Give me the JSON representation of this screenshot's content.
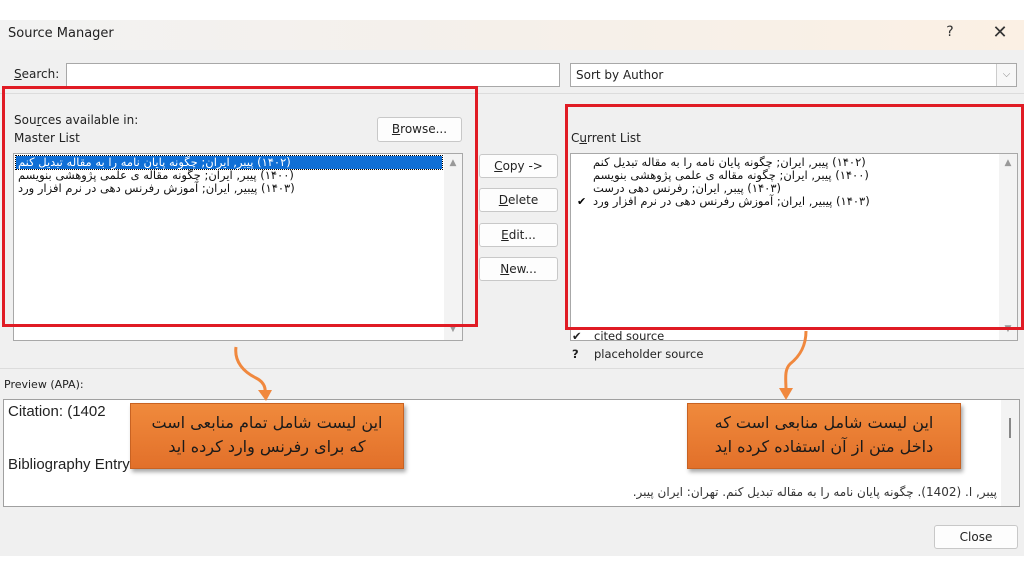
{
  "window": {
    "title": "Source Manager",
    "help_label": "?",
    "close_label": "✕"
  },
  "search": {
    "label_prefix": "",
    "label_underlined": "S",
    "label_rest": "earch:",
    "value": "",
    "placeholder": ""
  },
  "sort": {
    "selected": "Sort by Author",
    "arrow": "⌵"
  },
  "master": {
    "label_line1_a": "Sou",
    "label_line1_u": "r",
    "label_line1_b": "ces available in:",
    "label_line2": "Master List",
    "browse_u": "B",
    "browse_rest": "rowse...",
    "items": [
      {
        "text": "(۱۴۰۲) پیبر, ایران; چگونه پایان نامه را به مقاله تبدیل کنم",
        "selected": true
      },
      {
        "text": "(۱۴۰۰) پیبر, ایران; چگونه مقاله ی علمی پژوهشی بنویسم",
        "selected": false
      },
      {
        "text": "(۱۴۰۳) پیبیر, ایران; آموزش رفرنس دهی در نرم افزار ورد",
        "selected": false
      }
    ]
  },
  "actions": {
    "copy_u": "C",
    "copy_rest": "opy ->",
    "delete_u": "D",
    "delete_rest": "elete",
    "edit_u": "E",
    "edit_rest": "dit...",
    "new_u": "N",
    "new_rest": "ew..."
  },
  "current": {
    "label_a": "C",
    "label_u": "u",
    "label_b": "rrent List",
    "items": [
      {
        "text": "(۱۴۰۲) پیبر, ایران; چگونه پایان نامه را به مقاله تبدیل کنم",
        "cited": false
      },
      {
        "text": "(۱۴۰۰) پیبر, ایران; چگونه مقاله ی علمی پژوهشی بنویسم",
        "cited": false
      },
      {
        "text": "(۱۴۰۳) پیبر, ایران; رفرنس دهی درست",
        "cited": false
      },
      {
        "text": "(۱۴۰۳) پیبیر, ایران; آموزش رفرنس دهی در نرم افزار ورد",
        "cited": true
      }
    ],
    "check_symbol": "✔"
  },
  "legend": {
    "cited_symbol": "✔",
    "cited_label": "cited source",
    "placeholder_symbol": "?",
    "placeholder_label": "placeholder source"
  },
  "preview": {
    "label": "Preview (APA):",
    "citation": "Citation:  (1402",
    "bibliography": "Bibliography Entry:",
    "entry": "پیبر, ا. (1402). چگونه پایان نامه را به مقاله تبدیل کنم. تهران: ایران پیبر."
  },
  "close_button": "Close",
  "annotations": {
    "left_line1": "این لیست شامل تمام منابعی است",
    "left_line2": "که برای رفرنس وارد کرده اید",
    "right_line1": "این لیست شامل منابعی است که",
    "right_line2": "داخل متن از آن استفاده کرده اید",
    "highlight_color": "#e01b24",
    "arrow_color": "#f0883e",
    "callout_color": "#e87830"
  }
}
